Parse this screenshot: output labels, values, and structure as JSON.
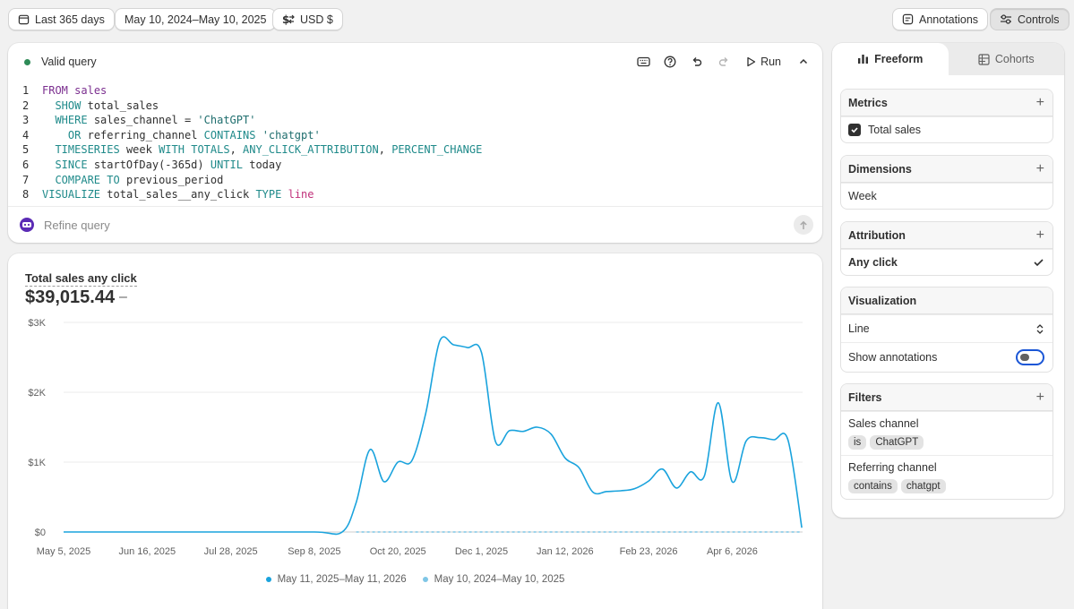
{
  "topbar": {
    "range_label": "Last 365 days",
    "dates_label": "May 10, 2024–May 10, 2025",
    "currency_label": "USD $",
    "annotations_label": "Annotations",
    "controls_label": "Controls"
  },
  "query": {
    "status": "Valid query",
    "run_label": "Run",
    "refine_placeholder": "Refine query",
    "lines": [
      {
        "num": "1",
        "text": "FROM sales"
      },
      {
        "num": "2",
        "text": "  SHOW total_sales"
      },
      {
        "num": "3",
        "text": "  WHERE sales_channel = 'ChatGPT'"
      },
      {
        "num": "4",
        "text": "    OR referring_channel CONTAINS 'chatgpt'"
      },
      {
        "num": "5",
        "text": "  TIMESERIES week WITH TOTALS, ANY_CLICK_ATTRIBUTION, PERCENT_CHANGE"
      },
      {
        "num": "6",
        "text": "  SINCE startOfDay(-365d) UNTIL today"
      },
      {
        "num": "7",
        "text": "  COMPARE TO previous_period"
      },
      {
        "num": "8",
        "text": "VISUALIZE total_sales__any_click TYPE line"
      }
    ]
  },
  "chart": {
    "title": "Total sales any click",
    "total": "$39,015.44",
    "change": "–",
    "legend": [
      {
        "label": "May 11, 2025–May 11, 2026",
        "color": "#1aa3dd"
      },
      {
        "label": "May 10, 2024–May 10, 2025",
        "color": "#7fc6e6"
      }
    ]
  },
  "chart_data": {
    "type": "line",
    "title": "Total sales any click",
    "xlabel": "",
    "ylabel": "",
    "ylim": [
      0,
      3000
    ],
    "y_ticks": [
      {
        "v": 0,
        "label": "$0"
      },
      {
        "v": 1000,
        "label": "$1K"
      },
      {
        "v": 2000,
        "label": "$2K"
      },
      {
        "v": 3000,
        "label": "$3K"
      }
    ],
    "x_ticks": [
      "May 5, 2025",
      "Jun 16, 2025",
      "Jul 28, 2025",
      "Sep 8, 2025",
      "Oct 20, 2025",
      "Dec 1, 2025",
      "Jan 12, 2026",
      "Feb 23, 2026",
      "Apr 6, 2026"
    ],
    "grid": true,
    "legend_position": "bottom",
    "series": [
      {
        "name": "May 11, 2025–May 11, 2026",
        "color": "#1aa3dd",
        "style": "solid",
        "x": [
          "May 5, 2025",
          "Jun 16, 2025",
          "Jul 28, 2025",
          "Sep 8, 2025",
          "Sep 22, 2025",
          "Sep 29, 2025",
          "Oct 6, 2025",
          "Oct 13, 2025",
          "Oct 20, 2025",
          "Oct 27, 2025",
          "Nov 3, 2025",
          "Nov 10, 2025",
          "Nov 17, 2025",
          "Nov 24, 2025",
          "Dec 1, 2025",
          "Dec 8, 2025",
          "Dec 15, 2025",
          "Dec 22, 2025",
          "Dec 29, 2025",
          "Jan 5, 2026",
          "Jan 12, 2026",
          "Jan 19, 2026",
          "Jan 26, 2026",
          "Feb 2, 2026",
          "Feb 9, 2026",
          "Feb 16, 2026",
          "Feb 23, 2026",
          "Mar 2, 2026",
          "Mar 9, 2026",
          "Mar 16, 2026",
          "Mar 23, 2026",
          "Mar 30, 2026",
          "Apr 6, 2026",
          "Apr 13, 2026",
          "Apr 20, 2026",
          "Apr 27, 2026",
          "May 4, 2026",
          "May 11, 2026"
        ],
        "values": [
          0,
          0,
          0,
          0,
          0,
          420,
          1180,
          720,
          1000,
          1020,
          1700,
          2730,
          2680,
          2640,
          2570,
          1300,
          1450,
          1440,
          1500,
          1400,
          1060,
          920,
          570,
          580,
          590,
          620,
          730,
          900,
          630,
          860,
          800,
          1850,
          720,
          1300,
          1350,
          1320,
          1320,
          60
        ]
      },
      {
        "name": "May 10, 2024–May 10, 2025",
        "color": "#7fc6e6",
        "style": "dashed",
        "x": [
          "Sep 29, 2025",
          "May 11, 2026"
        ],
        "values": [
          0,
          0
        ]
      }
    ]
  },
  "panel": {
    "tab_freeform": "Freeform",
    "tab_cohorts": "Cohorts",
    "metrics_title": "Metrics",
    "metric_item": "Total sales",
    "dimensions_title": "Dimensions",
    "dimension_item": "Week",
    "attribution_title": "Attribution",
    "attribution_item": "Any click",
    "visualization_title": "Visualization",
    "visualization_type": "Line",
    "show_annotations": "Show annotations",
    "filters_title": "Filters",
    "filter1_label": "Sales channel",
    "filter1_op": "is",
    "filter1_value": "ChatGPT",
    "filter2_label": "Referring channel",
    "filter2_op": "contains",
    "filter2_value": "chatgpt"
  }
}
